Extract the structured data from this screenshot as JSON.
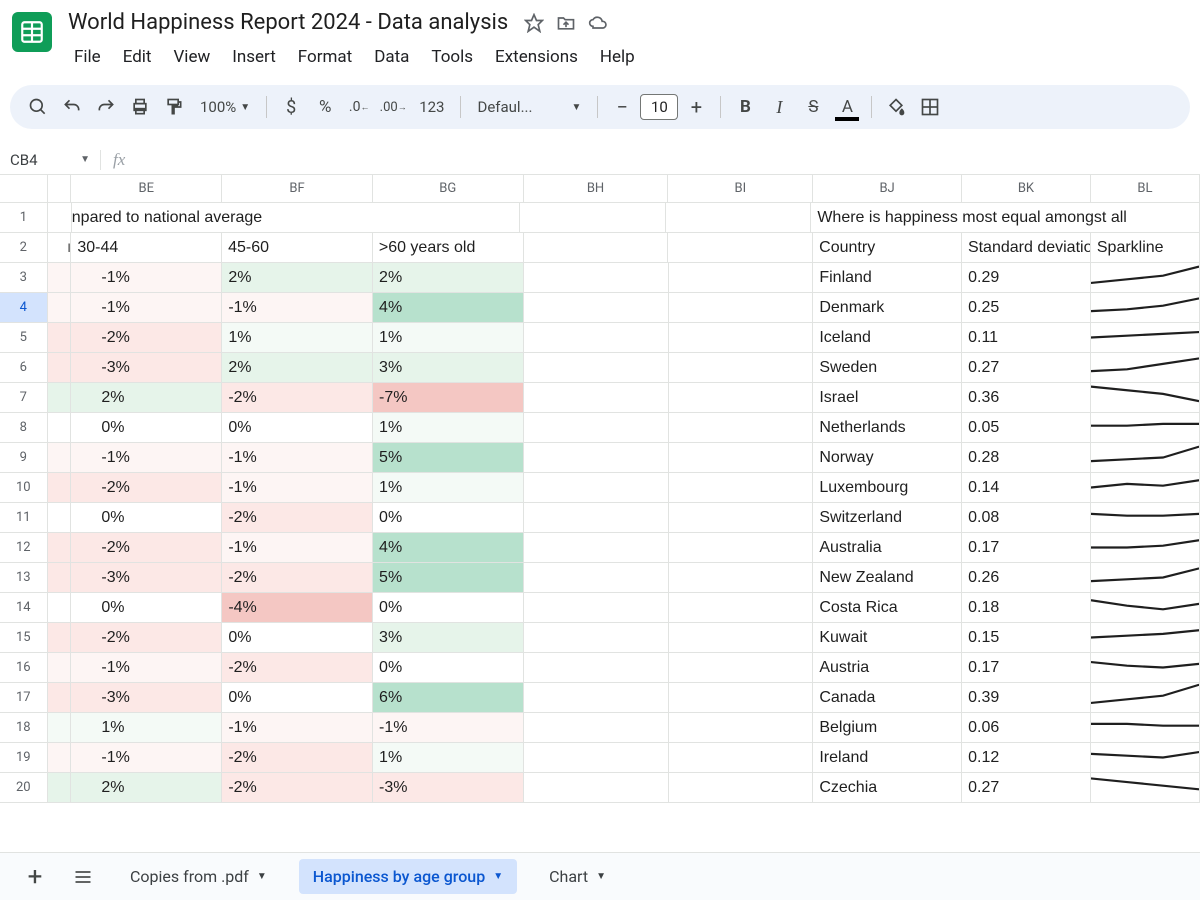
{
  "doc": {
    "title": "World Happiness Report 2024 - Data analysis"
  },
  "menus": [
    "File",
    "Edit",
    "View",
    "Insert",
    "Format",
    "Data",
    "Tools",
    "Extensions",
    "Help"
  ],
  "toolbar": {
    "zoom": "100%",
    "font": "Defaul...",
    "fontSize": "10",
    "fmt123": "123"
  },
  "nameBox": "CB4",
  "columns": [
    "BE",
    "BF",
    "BG",
    "BH",
    "BI",
    "BJ",
    "BK",
    "BL"
  ],
  "row1": {
    "BE": "npared to national average",
    "BJ": "Where is happiness most equal amongst all"
  },
  "row2": {
    "BE": "30-44",
    "BF": "45-60",
    "BG": ">60 years old",
    "BJ": "Country",
    "BK": "Standard deviatio",
    "BL": "Sparkline"
  },
  "dataRows": [
    {
      "n": 3,
      "be": "-1%",
      "bf": "2%",
      "bg": "2%",
      "bj": "Finland",
      "bk": "0.29",
      "spark": [
        5,
        7,
        9,
        14
      ]
    },
    {
      "n": 4,
      "be": "-1%",
      "bf": "-1%",
      "bg": "4%",
      "bj": "Denmark",
      "bk": "0.25",
      "spark": [
        6,
        7,
        9,
        13
      ]
    },
    {
      "n": 5,
      "be": "-2%",
      "bf": "1%",
      "bg": "1%",
      "bj": "Iceland",
      "bk": "0.11",
      "spark": [
        8,
        9,
        10,
        11
      ]
    },
    {
      "n": 6,
      "be": "-3%",
      "bf": "2%",
      "bg": "3%",
      "bj": "Sweden",
      "bk": "0.27",
      "spark": [
        6,
        7,
        10,
        13
      ]
    },
    {
      "n": 7,
      "be": "2%",
      "bf": "-2%",
      "bg": "-7%",
      "bj": "Israel",
      "bk": "0.36",
      "spark": [
        14,
        12,
        10,
        6
      ]
    },
    {
      "n": 8,
      "be": "0%",
      "bf": "0%",
      "bg": "1%",
      "bj": "Netherlands",
      "bk": "0.05",
      "spark": [
        9,
        9,
        10,
        10
      ]
    },
    {
      "n": 9,
      "be": "-1%",
      "bf": "-1%",
      "bg": "5%",
      "bj": "Norway",
      "bk": "0.28",
      "spark": [
        6,
        7,
        8,
        14
      ]
    },
    {
      "n": 10,
      "be": "-2%",
      "bf": "-1%",
      "bg": "1%",
      "bj": "Luxembourg",
      "bk": "0.14",
      "spark": [
        8,
        10,
        9,
        12
      ]
    },
    {
      "n": 11,
      "be": "0%",
      "bf": "-2%",
      "bg": "0%",
      "bj": "Switzerland",
      "bk": "0.08",
      "spark": [
        10,
        9,
        9,
        10
      ]
    },
    {
      "n": 12,
      "be": "-2%",
      "bf": "-1%",
      "bg": "4%",
      "bj": "Australia",
      "bk": "0.17",
      "spark": [
        8,
        8,
        9,
        12
      ]
    },
    {
      "n": 13,
      "be": "-3%",
      "bf": "-2%",
      "bg": "5%",
      "bj": "New Zealand",
      "bk": "0.26",
      "spark": [
        6,
        7,
        8,
        13
      ]
    },
    {
      "n": 14,
      "be": "0%",
      "bf": "-4%",
      "bg": "0%",
      "bj": "Costa Rica",
      "bk": "0.18",
      "spark": [
        12,
        9,
        7,
        10
      ]
    },
    {
      "n": 15,
      "be": "-2%",
      "bf": "0%",
      "bg": "3%",
      "bj": "Kuwait",
      "bk": "0.15",
      "spark": [
        8,
        9,
        10,
        12
      ]
    },
    {
      "n": 16,
      "be": "-1%",
      "bf": "-2%",
      "bg": "0%",
      "bj": "Austria",
      "bk": "0.17",
      "spark": [
        11,
        9,
        8,
        10
      ]
    },
    {
      "n": 17,
      "be": "-3%",
      "bf": "0%",
      "bg": "6%",
      "bj": "Canada",
      "bk": "0.39",
      "spark": [
        5,
        7,
        9,
        15
      ]
    },
    {
      "n": 18,
      "be": "1%",
      "bf": "-1%",
      "bg": "-1%",
      "bj": "Belgium",
      "bk": "0.06",
      "spark": [
        10,
        10,
        9,
        9
      ]
    },
    {
      "n": 19,
      "be": "-1%",
      "bf": "-2%",
      "bg": "1%",
      "bj": "Ireland",
      "bk": "0.12",
      "spark": [
        10,
        9,
        8,
        11
      ]
    },
    {
      "n": 20,
      "be": "2%",
      "bf": "-2%",
      "bg": "-3%",
      "bj": "Czechia",
      "bk": "0.27",
      "spark": [
        13,
        11,
        9,
        7
      ]
    }
  ],
  "heatmap": {
    "posMax": "#b7e1cd",
    "posMid": "#e6f4ea",
    "posLow": "#f4faf6",
    "negMax": "#f4c7c3",
    "negMid": "#fce8e6",
    "negLow": "#fdf5f4",
    "neutral": "#ffffff"
  },
  "tabs": {
    "sheet1": "Copies from .pdf",
    "sheet2": "Happiness by age group",
    "sheet3": "Chart"
  }
}
